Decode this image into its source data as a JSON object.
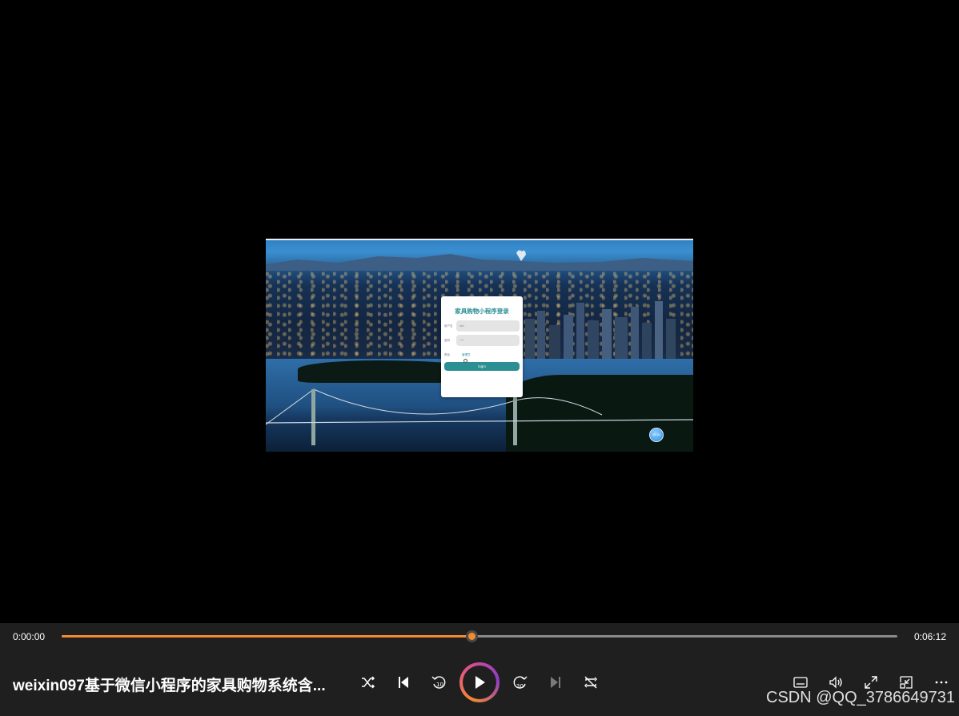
{
  "video": {
    "login": {
      "title": "家具购物小程序登录",
      "username_label": "用户名",
      "username_value": "abc",
      "password_label": "密码",
      "password_value": "•••",
      "role_label": "角色",
      "role_option": "管理员",
      "button_label": "login"
    },
    "badge_text": "00:04"
  },
  "controls": {
    "current_time": "0:00:00",
    "total_time": "0:06:12",
    "progress_fraction": 0.49,
    "title": "weixin097基于微信小程序的家具购物系统含...",
    "buttons": [
      "shuffle-icon",
      "previous-icon",
      "rewind-10-icon",
      "play-icon",
      "forward-30-icon",
      "next-icon",
      "repeat-off-icon",
      "captions-icon",
      "volume-icon",
      "fullscreen-icon",
      "mini-player-icon",
      "more-icon"
    ],
    "accent_color": "#f28b30"
  },
  "watermark": "CSDN @QQ_3786649731"
}
